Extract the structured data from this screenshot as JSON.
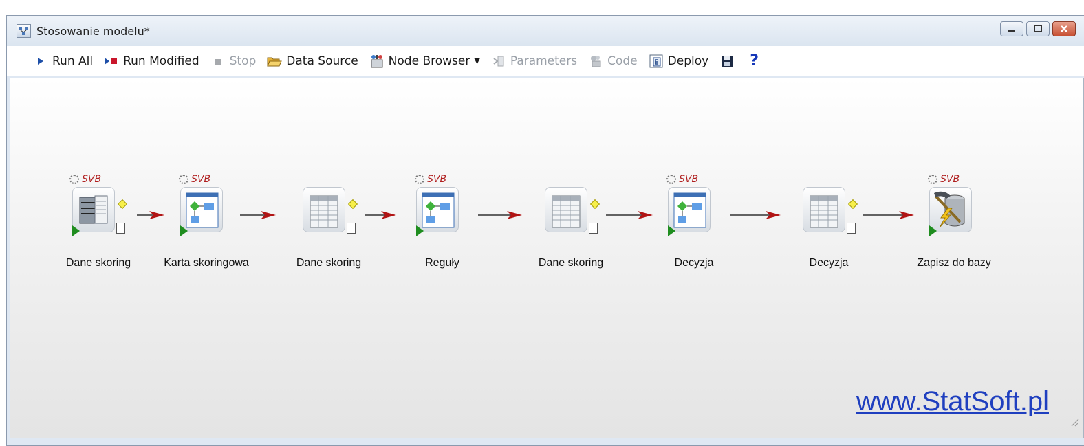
{
  "window": {
    "title": "Stosowanie modelu*"
  },
  "toolbar": {
    "run_all": "Run All",
    "run_modified": "Run Modified",
    "stop": "Stop",
    "data_source": "Data Source",
    "node_browser": "Node Browser",
    "parameters": "Parameters",
    "code": "Code",
    "deploy": "Deploy",
    "help": "?"
  },
  "nodes": [
    {
      "label": "Dane skoring",
      "badge": "SVB",
      "icon": "database-icon"
    },
    {
      "label": "Karta skoringowa",
      "badge": "SVB",
      "icon": "flowchart-icon"
    },
    {
      "label": "Dane skoring",
      "badge": "",
      "icon": "spreadsheet-icon"
    },
    {
      "label": "Reguły",
      "badge": "SVB",
      "icon": "flowchart-icon"
    },
    {
      "label": "Dane skoring",
      "badge": "",
      "icon": "spreadsheet-icon"
    },
    {
      "label": "Decyzja",
      "badge": "SVB",
      "icon": "flowchart-icon"
    },
    {
      "label": "Decyzja",
      "badge": "",
      "icon": "spreadsheet-icon"
    },
    {
      "label": "Zapisz do bazy",
      "badge": "SVB",
      "icon": "database-write-icon"
    }
  ],
  "watermark": {
    "link_text": "www.StatSoft.pl"
  },
  "colors": {
    "arrow": "#b11414",
    "link": "#1f3fbf",
    "badge": "#b01f1f"
  }
}
